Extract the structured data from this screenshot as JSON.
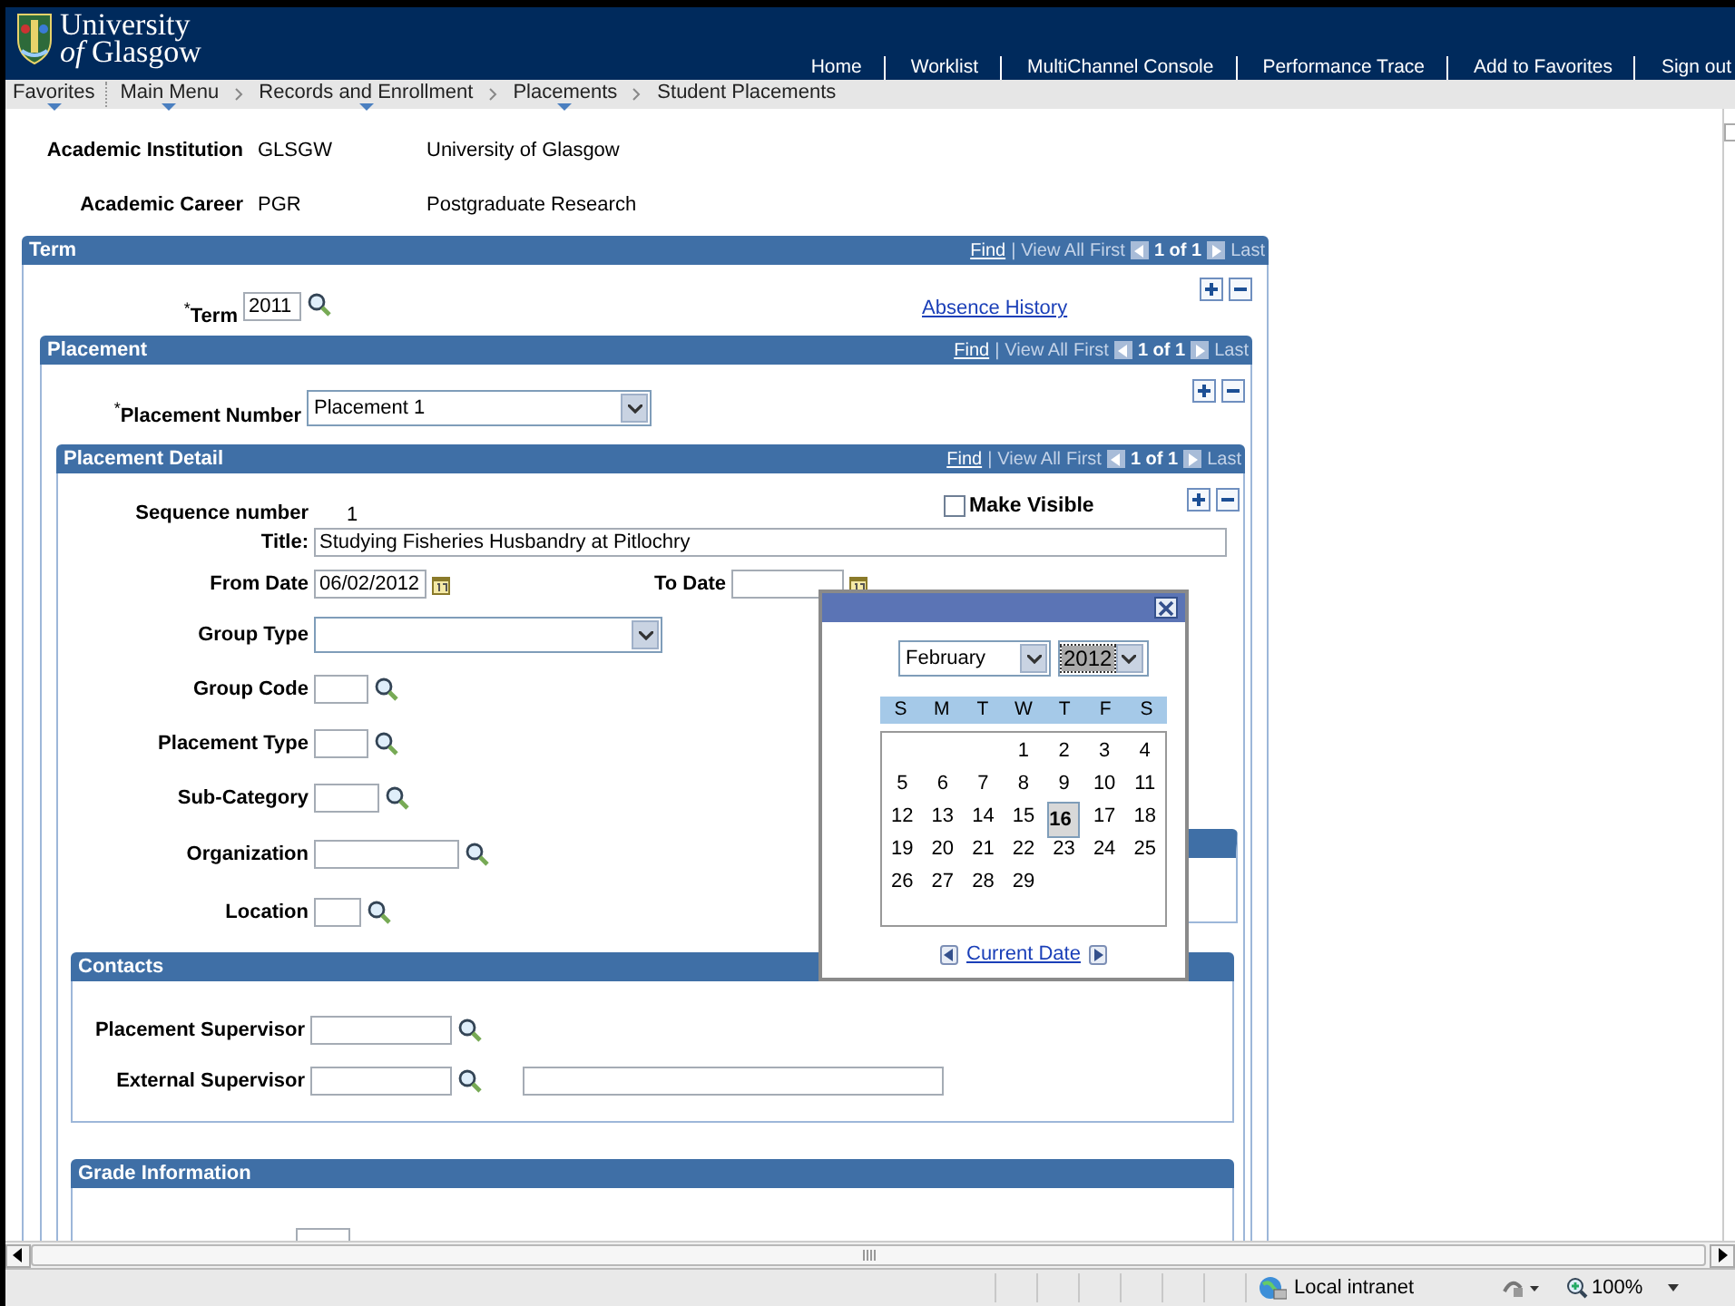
{
  "header": {
    "logo_line1": "University",
    "logo_line2": "*of* Glasgow",
    "links": [
      "Home",
      "Worklist",
      "MultiChannel Console",
      "Performance Trace",
      "Add to Favorites",
      "Sign out"
    ]
  },
  "breadcrumb": [
    {
      "label": "Favorites",
      "menu": true
    },
    {
      "label": "Main Menu",
      "menu": true
    },
    {
      "label": "Records and Enrollment",
      "menu": true
    },
    {
      "label": "Placements",
      "menu": true
    },
    {
      "label": "Student Placements",
      "menu": false
    }
  ],
  "summary": [
    {
      "label": "Academic Institution",
      "code": "GLSGW",
      "description": "University of Glasgow"
    },
    {
      "label": "Academic Career",
      "code": "PGR",
      "description": "Postgraduate Research"
    }
  ],
  "term_section": {
    "title": "Term",
    "required_mark": "*",
    "nav": {
      "find": "Find",
      "separator": "|",
      "view_all": "View All",
      "first": "First",
      "count": "1 of 1",
      "last": "Last"
    },
    "term_label": "Term",
    "term_value": "2011",
    "link": "Absence History"
  },
  "placement_section": {
    "title": "Placement",
    "required_mark": "*",
    "nav": {
      "find": "Find",
      "separator": "|",
      "view_all": "View All",
      "first": "First",
      "count": "1 of 1",
      "last": "Last"
    },
    "number_label": "Placement Number",
    "number_value": "Placement 1"
  },
  "detail_section": {
    "title": "Placement Detail",
    "nav": {
      "find": "Find",
      "separator": "|",
      "view_all": "View All",
      "first": "First",
      "count": "1 of 1",
      "last": "Last"
    },
    "sequence_label": "Sequence number",
    "sequence_value": "1",
    "make_visible": {
      "label": "Make Visible",
      "checked": false
    },
    "title_label": "Title:",
    "title_value": "Studying Fisheries Husbandry at Pitlochry",
    "from_label": "From Date",
    "from_value": "06/02/2012",
    "to_label": "To Date",
    "group_type_label": "Group Type",
    "lookups": [
      {
        "label": "Group Code"
      },
      {
        "label": "Placement Type"
      },
      {
        "label": "Sub-Category"
      },
      {
        "label": "Organization"
      },
      {
        "label": "Location"
      }
    ]
  },
  "contacts_section": {
    "title": "Contacts",
    "rows": [
      {
        "label": "Placement Supervisor",
        "kind": "lookup"
      },
      {
        "label": "External Supervisor",
        "kind": "lookup_description"
      }
    ]
  },
  "grade_section": {
    "title": "Grade Information"
  },
  "calendar": {
    "month": "February",
    "year": "2012",
    "weekdays": [
      "S",
      "M",
      "T",
      "W",
      "T",
      "F",
      "S"
    ],
    "weeks": [
      [
        {
          "kind": "blank"
        },
        {
          "kind": "blank"
        },
        {
          "kind": "blank"
        },
        {
          "day": "1",
          "selected": false
        },
        {
          "day": "2",
          "selected": false
        },
        {
          "day": "3",
          "selected": false
        },
        {
          "day": "4",
          "selected": false
        }
      ],
      [
        {
          "day": "5",
          "selected": false
        },
        {
          "day": "6",
          "selected": false
        },
        {
          "day": "7",
          "selected": false
        },
        {
          "day": "8",
          "selected": false
        },
        {
          "day": "9",
          "selected": false
        },
        {
          "day": "10",
          "selected": false
        },
        {
          "day": "11",
          "selected": false
        }
      ],
      [
        {
          "day": "12",
          "selected": false
        },
        {
          "day": "13",
          "selected": false
        },
        {
          "day": "14",
          "selected": false
        },
        {
          "day": "15",
          "selected": false
        },
        {
          "day": "16",
          "selected": true
        },
        {
          "day": "17",
          "selected": false
        },
        {
          "day": "18",
          "selected": false
        }
      ],
      [
        {
          "day": "19",
          "selected": false
        },
        {
          "day": "20",
          "selected": false
        },
        {
          "day": "21",
          "selected": false
        },
        {
          "day": "22",
          "selected": false
        },
        {
          "day": "23",
          "selected": false
        },
        {
          "day": "24",
          "selected": false
        },
        {
          "day": "25",
          "selected": false
        }
      ],
      [
        {
          "day": "26",
          "selected": false
        },
        {
          "day": "27",
          "selected": false
        },
        {
          "day": "28",
          "selected": false
        },
        {
          "day": "29",
          "selected": false
        },
        {
          "kind": "blank"
        },
        {
          "kind": "blank"
        },
        {
          "kind": "blank"
        }
      ]
    ],
    "current_date": "Current Date"
  },
  "status_bar": {
    "zone": "Local intranet",
    "zoom": "100%"
  }
}
